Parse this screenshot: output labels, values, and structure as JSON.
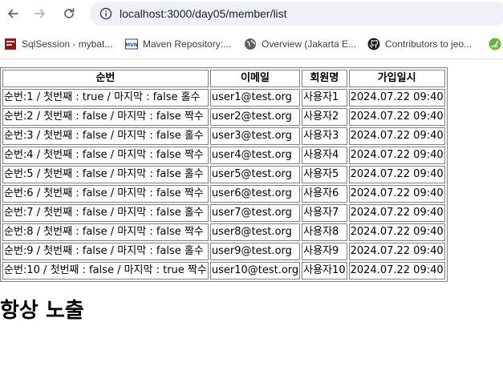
{
  "browser": {
    "url": "localhost:3000/day05/member/list",
    "bookmarks": [
      {
        "label": "SqlSession - mybat...",
        "icon": "mybatis-icon"
      },
      {
        "label": "Maven Repository:...",
        "icon": "maven-icon"
      },
      {
        "label": "Overview (Jakarta E...",
        "icon": "globe-icon"
      },
      {
        "label": "Contributors to jeo...",
        "icon": "github-icon"
      }
    ]
  },
  "table": {
    "headers": [
      "순번",
      "이메일",
      "회원명",
      "가입일시"
    ],
    "rows": [
      [
        "순번:1 / 첫번째 : true / 마지막 : false 홀수",
        "user1@test.org",
        "사용자1",
        "2024.07.22 09:40"
      ],
      [
        "순번:2 / 첫번째 : false / 마지막 : false 짝수",
        "user2@test.org",
        "사용자2",
        "2024.07.22 09:40"
      ],
      [
        "순번:3 / 첫번째 : false / 마지막 : false 홀수",
        "user3@test.org",
        "사용자3",
        "2024.07.22 09:40"
      ],
      [
        "순번:4 / 첫번째 : false / 마지막 : false 짝수",
        "user4@test.org",
        "사용자4",
        "2024.07.22 09:40"
      ],
      [
        "순번:5 / 첫번째 : false / 마지막 : false 홀수",
        "user5@test.org",
        "사용자5",
        "2024.07.22 09:40"
      ],
      [
        "순번:6 / 첫번째 : false / 마지막 : false 짝수",
        "user6@test.org",
        "사용자6",
        "2024.07.22 09:40"
      ],
      [
        "순번:7 / 첫번째 : false / 마지막 : false 홀수",
        "user7@test.org",
        "사용자7",
        "2024.07.22 09:40"
      ],
      [
        "순번:8 / 첫번째 : false / 마지막 : false 짝수",
        "user8@test.org",
        "사용자8",
        "2024.07.22 09:40"
      ],
      [
        "순번:9 / 첫번째 : false / 마지막 : false 홀수",
        "user9@test.org",
        "사용자9",
        "2024.07.22 09:40"
      ],
      [
        "순번:10 / 첫번째 : false / 마지막 : true 짝수",
        "user10@test.org",
        "사용자10",
        "2024.07.22 09:40"
      ]
    ]
  },
  "footer_heading": "항상 노출"
}
